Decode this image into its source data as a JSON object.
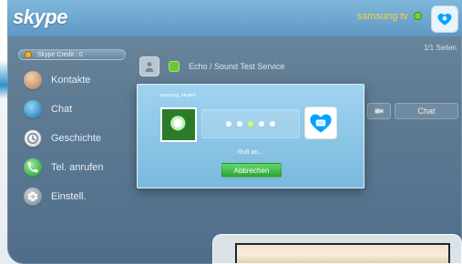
{
  "topbar": {
    "logo_text": "skype",
    "user_name": "samsung tv",
    "status_color": "#7bd13a"
  },
  "pagination": {
    "text": "1/1 Seiten"
  },
  "credit": {
    "label": "Skype Credit : 0"
  },
  "sidebar": {
    "items": [
      {
        "label": "Kontakte",
        "icon": "contacts-icon"
      },
      {
        "label": "Chat",
        "icon": "chat-icon"
      },
      {
        "label": "Geschichte",
        "icon": "history-clock-icon"
      },
      {
        "label": "Tel. anrufen",
        "icon": "phone-icon"
      },
      {
        "label": "Einstell.",
        "icon": "gear-icon"
      }
    ]
  },
  "contact": {
    "name": "Echo / Sound Test Service",
    "status_icon": "online-status-icon",
    "actions": {
      "chat_label": "Chat"
    }
  },
  "call_dialog": {
    "caller_user": "samsung_skype1",
    "status_text": "Ruft an...",
    "cancel_label": "Abbrechen",
    "progress_active_index": 2,
    "progress_total": 5
  }
}
